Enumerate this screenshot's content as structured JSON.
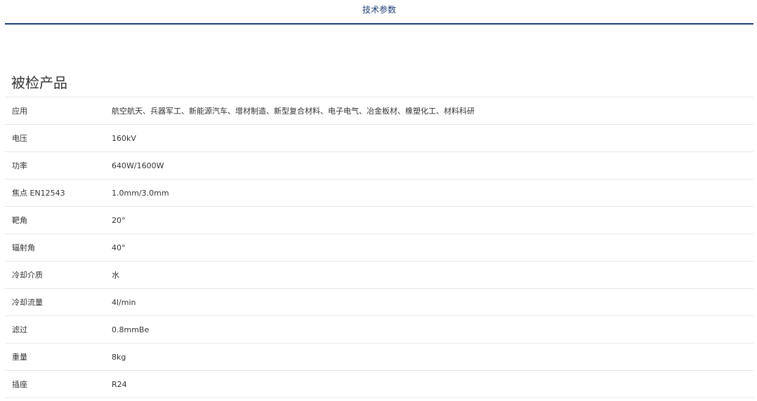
{
  "tabs": [
    {
      "label": "技术参数",
      "active": true
    }
  ],
  "section": {
    "title": "被检产品"
  },
  "specs": [
    {
      "label": "应用",
      "value": "航空航天、兵器军工、新能源汽车、增材制造、新型复合材料、电子电气、冶金板材、橡塑化工、材料科研"
    },
    {
      "label": "电压",
      "value": "160kV"
    },
    {
      "label": "功率",
      "value": "640W/1600W"
    },
    {
      "label": "焦点 EN12543",
      "value": "1.0mm/3.0mm"
    },
    {
      "label": "靶角",
      "value": "20°"
    },
    {
      "label": "辐射角",
      "value": "40°"
    },
    {
      "label": "冷却介质",
      "value": "水"
    },
    {
      "label": "冷却流量",
      "value": "4l/min"
    },
    {
      "label": "滤过",
      "value": "0.8mmBe"
    },
    {
      "label": "重量",
      "value": "8kg"
    },
    {
      "label": "插座",
      "value": "R24"
    }
  ],
  "colors": {
    "accent": "#1f3b73",
    "divider": "#e6e6e6",
    "text": "#333333"
  }
}
